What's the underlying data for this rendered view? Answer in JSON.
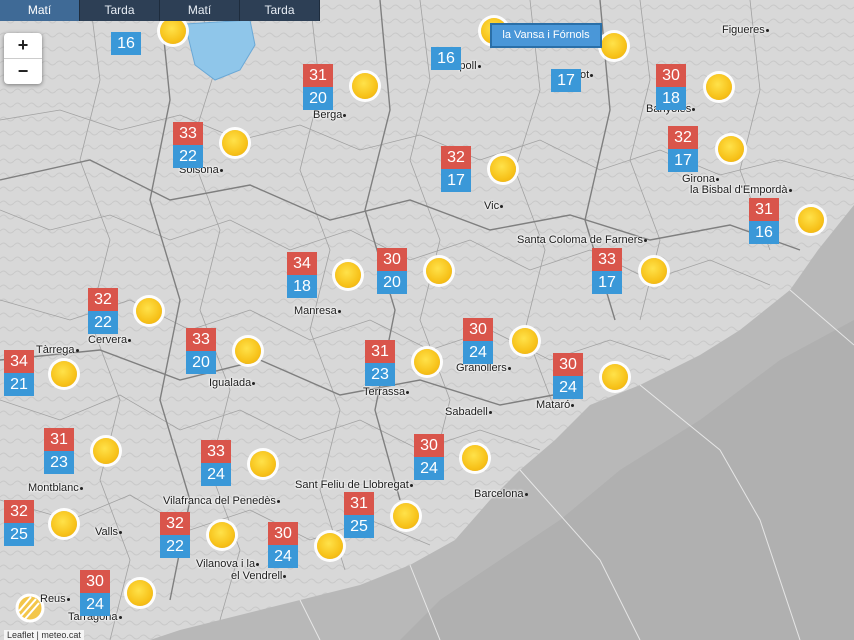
{
  "tabs": [
    {
      "label": "Matí",
      "active": true
    },
    {
      "label": "Tarda",
      "active": false
    },
    {
      "label": "Matí",
      "active": false
    },
    {
      "label": "Tarda",
      "active": false
    }
  ],
  "zoom": {
    "in_label": "+",
    "out_label": "−"
  },
  "tooltip": {
    "text": "la Vansa i Fórnols"
  },
  "attribution": {
    "text": "Leaflet | meteo.cat"
  },
  "colors": {
    "max_temp": "#d9554b",
    "min_temp": "#3a98d8",
    "sun": "#f7c21a",
    "sea": "#b8b8b8",
    "land": "#dcdcdc"
  },
  "places": [
    "Figueres",
    "Ripoll",
    "Olot",
    "Berga",
    "Banyoles",
    "Solsona",
    "Girona",
    "la Bisbal d'Empordà",
    "Vic",
    "Santa Coloma de Farners",
    "Manresa",
    "Tàrrega",
    "Cervera",
    "Igualada",
    "Granollers",
    "Terrassa",
    "Mataró",
    "Sabadell",
    "Montblanc",
    "Sant Feliu de Llobregat",
    "Barcelona",
    "Vilafranca del Penedès",
    "Valls",
    "Vilanova i la",
    "el Vendrell",
    "Reus",
    "Tarragona"
  ],
  "stations": [
    {
      "max": "",
      "min": "16",
      "icon": "sun-icon"
    },
    {
      "max": "",
      "min": "16",
      "icon": "sun-icon"
    },
    {
      "max": "",
      "min": "17",
      "icon": "sun-icon"
    },
    {
      "max": "31",
      "min": "20",
      "icon": "sun-icon"
    },
    {
      "max": "30",
      "min": "18",
      "icon": "sun-icon"
    },
    {
      "max": "33",
      "min": "22",
      "icon": "sun-icon"
    },
    {
      "max": "32",
      "min": "17",
      "icon": "sun-icon"
    },
    {
      "max": "32",
      "min": "17",
      "icon": "sun-icon"
    },
    {
      "max": "31",
      "min": "16",
      "icon": "sun-icon"
    },
    {
      "max": "34",
      "min": "18",
      "icon": "sun-icon"
    },
    {
      "max": "30",
      "min": "20",
      "icon": "sun-icon"
    },
    {
      "max": "33",
      "min": "17",
      "icon": "sun-icon"
    },
    {
      "max": "32",
      "min": "22",
      "icon": "sun-icon"
    },
    {
      "max": "33",
      "min": "20",
      "icon": "sun-icon"
    },
    {
      "max": "31",
      "min": "23",
      "icon": "sun-icon"
    },
    {
      "max": "30",
      "min": "24",
      "icon": "sun-icon"
    },
    {
      "max": "30",
      "min": "24",
      "icon": "sun-icon"
    },
    {
      "max": "34",
      "min": "21",
      "icon": "sun-icon"
    },
    {
      "max": "31",
      "min": "23",
      "icon": "sun-icon"
    },
    {
      "max": "33",
      "min": "24",
      "icon": "sun-icon"
    },
    {
      "max": "30",
      "min": "24",
      "icon": "sun-icon"
    },
    {
      "max": "32",
      "min": "25",
      "icon": "sun-icon"
    },
    {
      "max": "31",
      "min": "25",
      "icon": "sun-icon"
    },
    {
      "max": "32",
      "min": "22",
      "icon": "sun-icon"
    },
    {
      "max": "30",
      "min": "24",
      "icon": "sun-icon"
    },
    {
      "max": "30",
      "min": "24",
      "icon": "sun-icon"
    }
  ]
}
